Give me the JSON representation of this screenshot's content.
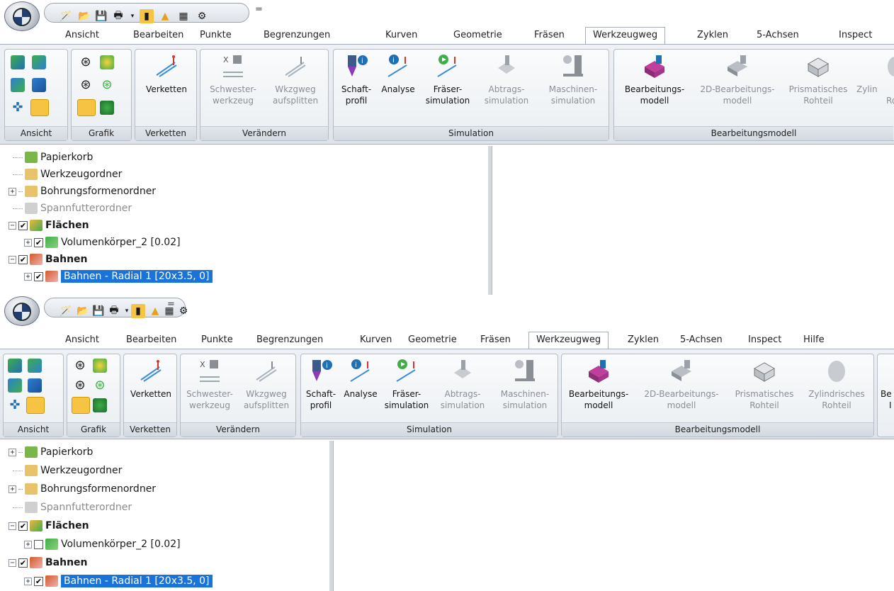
{
  "tabs": [
    "Ansicht",
    "Bearbeiten",
    "Punkte",
    "Begrenzungen",
    "Kurven",
    "Geometrie",
    "Fräsen",
    "Werkzeugweg",
    "Zyklen",
    "5-Achsen",
    "Inspect",
    "Hilfe"
  ],
  "active_tab": "Werkzeugweg",
  "qat_separator": "=",
  "ribbon": {
    "groups": {
      "ansicht": "Ansicht",
      "grafik": "Grafik",
      "verketten": "Verketten",
      "veraendern": "Verändern",
      "simulation": "Simulation",
      "bearbeitungsmodell": "Bearbeitungsmodell"
    },
    "buttons": {
      "verketten": "Verketten",
      "schwester_1": "Schwester-",
      "schwester_2": "werkzeug",
      "wkzgweg_1": "Wkzgweg",
      "wkzgweg_2": "aufsplitten",
      "schaft_1": "Schaft-",
      "schaft_2": "profil",
      "analyse": "Analyse",
      "fraeser_1": "Fräser-",
      "fraeser_2": "simulation",
      "abtrags_1": "Abtrags-",
      "abtrags_2": "simulation",
      "maschinen_1": "Maschinen-",
      "maschinen_2": "simulation",
      "bearb_1": "Bearbeitungs-",
      "bearb_2": "modell",
      "bearb2d_1": "2D-Bearbeitungs-",
      "bearb2d_2": "modell",
      "prism_1": "Prismatisches",
      "prism_2": "Rohteil",
      "zyl_1": "Zylindrisches",
      "zyl_2": "Rohteil",
      "zyl_trunc_1": "Zylin",
      "zyl_trunc_2": "Ro",
      "last_trunc_1": "Be",
      "last_trunc_2": "I"
    }
  },
  "tree": {
    "papierkorb": "Papierkorb",
    "werkzeugordner": "Werkzeugordner",
    "bohrungsformenordner": "Bohrungsformenordner",
    "spannfutterordner": "Spannfutterordner",
    "flaechen": "Flächen",
    "volumenkoerper": "Volumenkörper_2 [0.02]",
    "bahnen": "Bahnen",
    "bahnen_radial": "Bahnen - Radial 1 [20x3.5, 0]"
  },
  "icons": {
    "papierkorb": "recycle-bin-icon",
    "werkzeugordner": "tool-folder-icon",
    "bohrungsformenordner": "drill-folder-icon",
    "spannfutterordner": "chuck-folder-icon",
    "flaechen": "surface-triangle-icon",
    "bahnen": "toolpath-icon"
  },
  "colors": {
    "selection": "#1a73d9",
    "ribbon_bg": "#e6eaef",
    "tab_active_bg": "#ffffff"
  }
}
